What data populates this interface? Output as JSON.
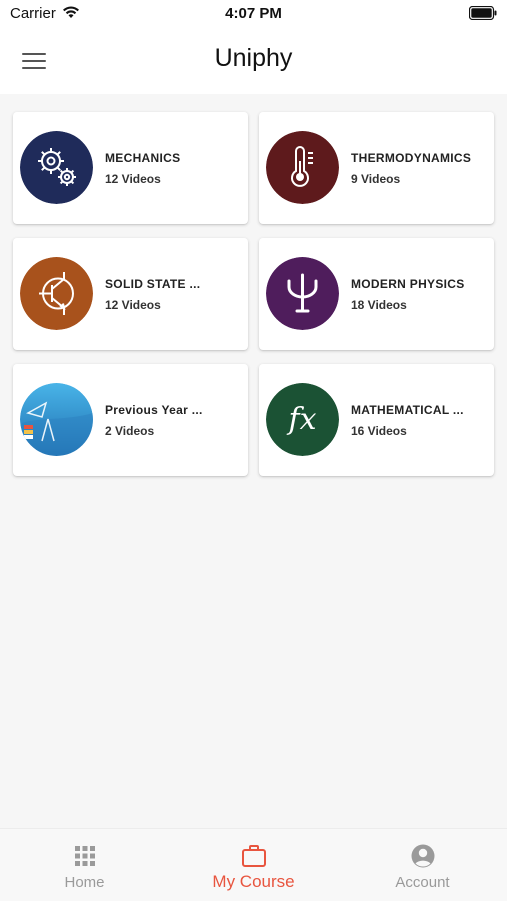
{
  "status_bar": {
    "carrier": "Carrier",
    "time": "4:07 PM",
    "wifi_icon": "wifi-icon",
    "battery_icon": "battery-icon"
  },
  "header": {
    "title": "Uniphy",
    "menu_icon": "hamburger-menu-icon"
  },
  "courses": [
    {
      "title": "MECHANICS",
      "subtitle": "12 Videos",
      "icon": "gears-icon",
      "color": "#1f2b5a"
    },
    {
      "title": "THERMODYNAMICS",
      "subtitle": "9 Videos",
      "icon": "thermometer-icon",
      "color": "#5e1a1c"
    },
    {
      "title": "SOLID STATE ...",
      "subtitle": "12 Videos",
      "icon": "transistor-icon",
      "color": "#a8521c"
    },
    {
      "title": "MODERN PHYSICS",
      "subtitle": "18 Videos",
      "icon": "psi-icon",
      "color": "#4f1d5c"
    },
    {
      "title": "Previous Year ...",
      "subtitle": "2 Videos",
      "icon": "exam-tools-icon",
      "color": "#2a8fd0"
    },
    {
      "title": "MATHEMATICAL ...",
      "subtitle": "16 Videos",
      "icon": "fx-icon",
      "color": "#1b5234",
      "glyph": "fx"
    }
  ],
  "tab_bar": {
    "tabs": [
      {
        "label": "Home",
        "icon": "grid-icon",
        "active": false
      },
      {
        "label": "My Course",
        "icon": "briefcase-icon",
        "active": true
      },
      {
        "label": "Account",
        "icon": "account-icon",
        "active": false
      }
    ],
    "active_color": "#e8553f",
    "inactive_color": "#9a9a9a"
  }
}
